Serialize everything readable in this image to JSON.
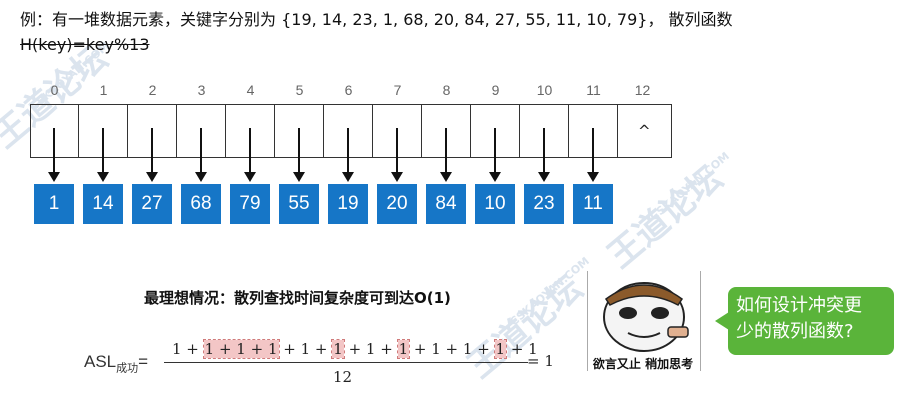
{
  "title": "例：有一堆数据元素，关键字分别为 {19, 14, 23, 1, 68, 20, 84, 27, 55, 11, 10, 79}， 散列函数",
  "hash_function": "H(key)=key%13",
  "indices": [
    "0",
    "1",
    "2",
    "3",
    "4",
    "5",
    "6",
    "7",
    "8",
    "9",
    "10",
    "11",
    "12"
  ],
  "null_symbol": "^",
  "nodes": [
    "1",
    "14",
    "27",
    "68",
    "79",
    "55",
    "19",
    "20",
    "84",
    "10",
    "23",
    "11"
  ],
  "colors": {
    "node_blue": "#1676c7",
    "bubble_green": "#5ab43a",
    "highlight": "#f3c6c6"
  },
  "heading": "最理想情况：散列查找时间复杂度可到达O(1)",
  "asl": {
    "label": "ASL",
    "label_sub": "成功",
    "equals": "=",
    "numerator_parts": [
      "1 + ",
      "1 + 1 + 1",
      " + 1 + ",
      "1",
      " + 1 + ",
      "1",
      " + 1 + 1 + ",
      "1",
      " + 1"
    ],
    "denominator": "12",
    "result": "= 1"
  },
  "meme": {
    "caption": "欲言又止 稍加思考"
  },
  "bubble": {
    "line1": "如何设计冲突更",
    "line2": "少的散列函数?"
  },
  "watermark": {
    "text1": "王道论坛",
    "text2": "CSKAOYAN.COM"
  }
}
